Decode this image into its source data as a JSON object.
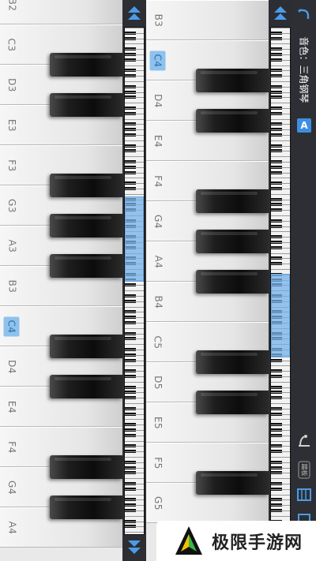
{
  "left_keyboard": {
    "white_keys": [
      {
        "note": "B2",
        "highlighted": false
      },
      {
        "note": "C3",
        "highlighted": false
      },
      {
        "note": "D3",
        "highlighted": false
      },
      {
        "note": "E3",
        "highlighted": false
      },
      {
        "note": "F3",
        "highlighted": false
      },
      {
        "note": "G3",
        "highlighted": false
      },
      {
        "note": "A3",
        "highlighted": false
      },
      {
        "note": "B3",
        "highlighted": false
      },
      {
        "note": "C4",
        "highlighted": true
      },
      {
        "note": "D4",
        "highlighted": false
      },
      {
        "note": "E4",
        "highlighted": false
      },
      {
        "note": "F4",
        "highlighted": false
      },
      {
        "note": "G4",
        "highlighted": false
      },
      {
        "note": "A4",
        "highlighted": false
      }
    ]
  },
  "right_keyboard": {
    "white_keys": [
      {
        "note": "B3",
        "highlighted": false
      },
      {
        "note": "C4",
        "highlighted": true
      },
      {
        "note": "D4",
        "highlighted": false
      },
      {
        "note": "E4",
        "highlighted": false
      },
      {
        "note": "F4",
        "highlighted": false
      },
      {
        "note": "G4",
        "highlighted": false
      },
      {
        "note": "A4",
        "highlighted": false
      },
      {
        "note": "B4",
        "highlighted": false
      },
      {
        "note": "C5",
        "highlighted": false
      },
      {
        "note": "D5",
        "highlighted": false
      },
      {
        "note": "E5",
        "highlighted": false
      },
      {
        "note": "F5",
        "highlighted": false
      },
      {
        "note": "G5",
        "highlighted": false
      }
    ]
  },
  "sidebar": {
    "instrument_label": "音色：三角钢琴",
    "mode_button": "A",
    "pedal_label": "踏板"
  },
  "watermark": {
    "text": "极限手游网"
  },
  "colors": {
    "highlight": "#8ec2ee",
    "accent": "#3c8fe0",
    "panel": "#2d2f34"
  }
}
